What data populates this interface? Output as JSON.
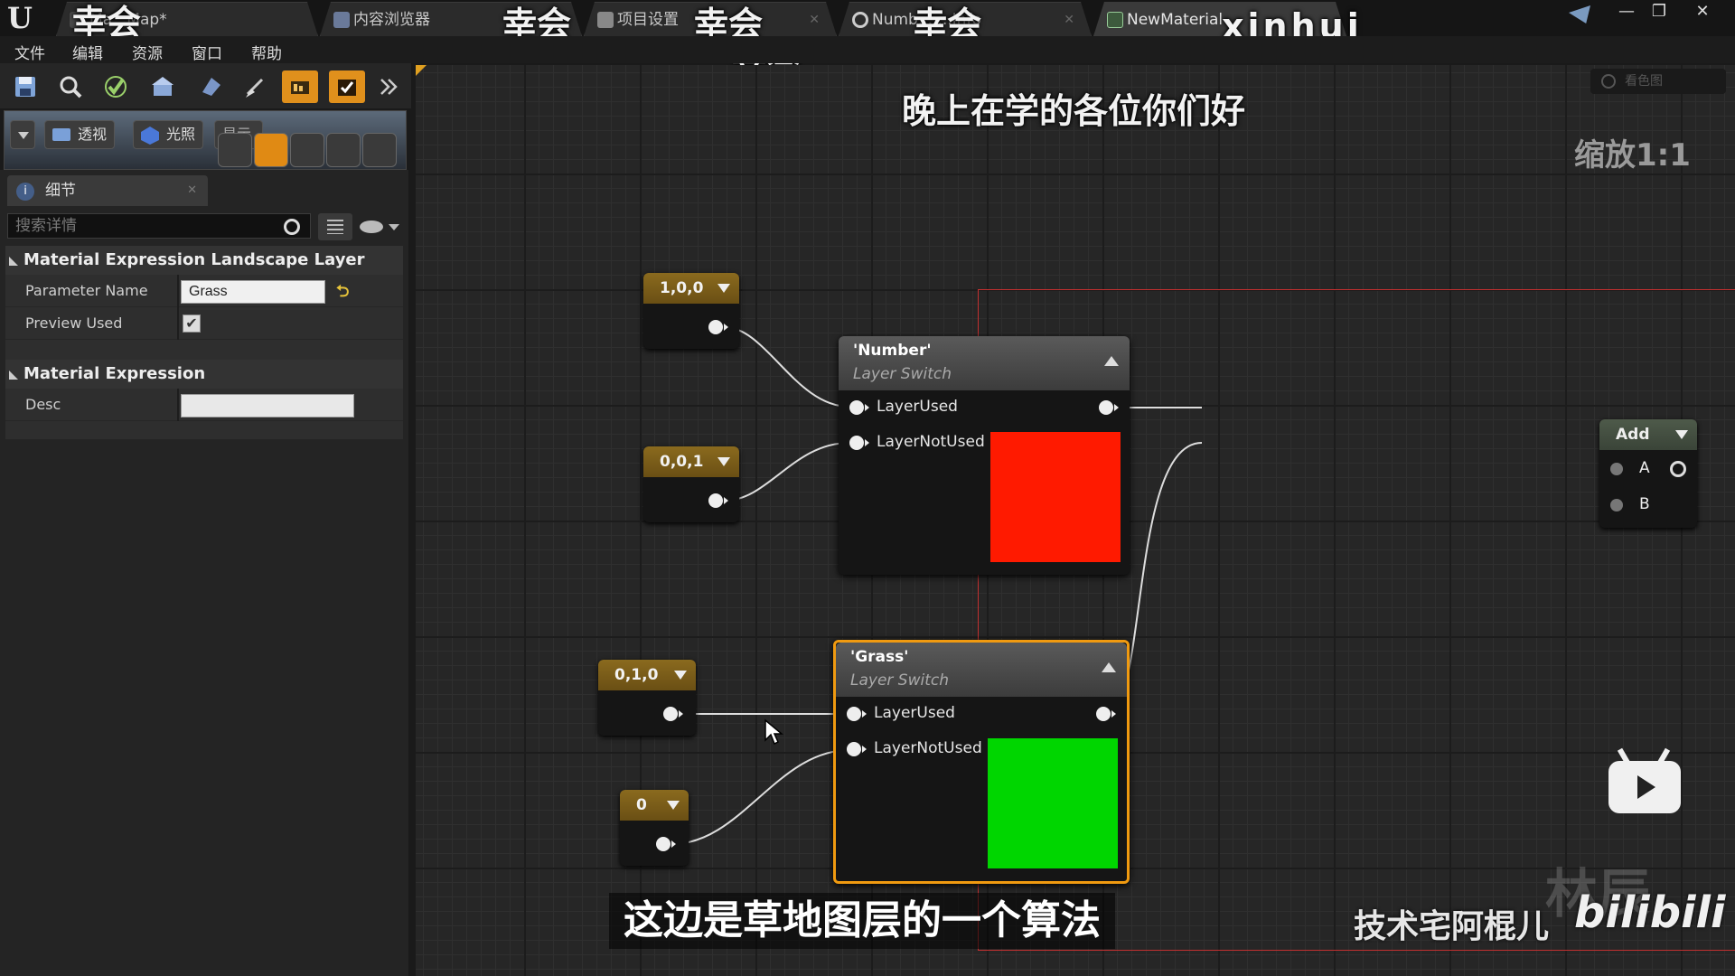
{
  "titlebar": {
    "tabs": [
      {
        "label": "Ma...Map*",
        "active": false
      },
      {
        "label": "内容浏览器",
        "active": false
      },
      {
        "label": "项目设置",
        "active": false
      },
      {
        "label": "Numb... ...Info",
        "active": false
      },
      {
        "label": "NewMaterial",
        "active": true
      }
    ],
    "watermarks": [
      "幸会",
      "幸会",
      "幸会",
      "幸会",
      "幸会",
      "xinhui",
      "晚上在学的各位你们好",
      "缩放1:1",
      "技术宅阿棍儿",
      "bilibili",
      "林辰"
    ],
    "window_buttons": [
      "—",
      "❐",
      "✕"
    ]
  },
  "menu": [
    "文件",
    "编辑",
    "资源",
    "窗口",
    "帮助"
  ],
  "toolbar": {
    "icons": [
      "save-icon",
      "browse-icon",
      "apply-icon",
      "home-icon",
      "node-icon",
      "clean-icon",
      "stats-icon",
      "live-update-icon",
      "more-icon"
    ]
  },
  "preview": {
    "perspective_label": "透视",
    "lit_label": "光照",
    "show_label": "显示"
  },
  "details": {
    "tab_label": "细节",
    "search_placeholder": "搜索详情",
    "section1": "Material Expression Landscape Layer Switch",
    "param_label": "Parameter Name",
    "param_value": "Grass",
    "preview_used_label": "Preview Used",
    "preview_used_checked": true,
    "section2": "Material Expression",
    "desc_label": "Desc",
    "desc_value": ""
  },
  "graph": {
    "zoom_label": "缩放1:1",
    "hint_label": "看色图",
    "constants": [
      {
        "label": "1,0,0"
      },
      {
        "label": "0,0,1"
      },
      {
        "label": "0,1,0"
      },
      {
        "label": "0"
      }
    ],
    "nodes": [
      {
        "title": "'Number'",
        "subtitle": "Layer Switch",
        "pin1": "LayerUsed",
        "pin2": "LayerNotUsed",
        "swatch": "#ff1a00"
      },
      {
        "title": "'Grass'",
        "subtitle": "Layer Switch",
        "pin1": "LayerUsed",
        "pin2": "LayerNotUsed",
        "swatch": "#00d600"
      }
    ],
    "add_node": {
      "title": "Add",
      "pin_a": "A",
      "pin_b": "B"
    }
  },
  "overlay": {
    "greeting": "晚上在学的各位你们好",
    "subtitle": "这边是草地图层的一个算法",
    "channel": "技术宅阿棍儿",
    "platform": "bilibili",
    "ghost": "林辰"
  },
  "colors": {
    "accent": "#f09a10",
    "selection": "#c23030",
    "red": "#ff1a00",
    "green": "#00d600"
  }
}
